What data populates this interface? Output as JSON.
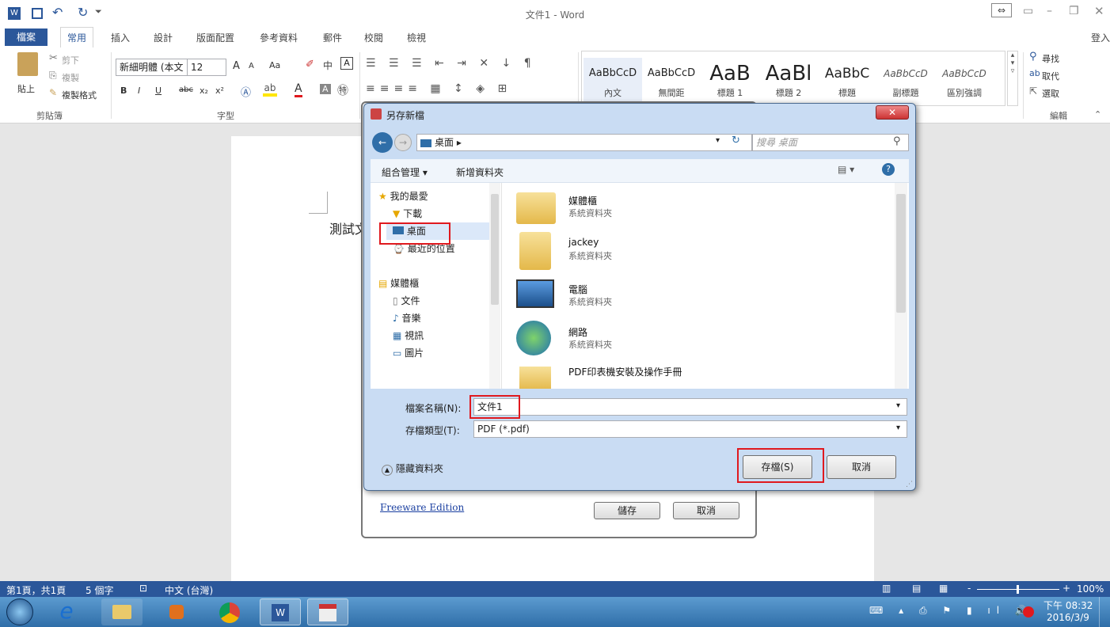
{
  "window": {
    "title": "文件1 - Word",
    "signin": "登入"
  },
  "ribbon_tabs": [
    "檔案",
    "常用",
    "插入",
    "設計",
    "版面配置",
    "參考資料",
    "郵件",
    "校閱",
    "檢視"
  ],
  "clipboard": {
    "paste": "貼上",
    "cut": "剪下",
    "copy": "複製",
    "format_painter": "複製格式",
    "group": "剪貼簿"
  },
  "font": {
    "name": "新細明體 (本文",
    "size": "12",
    "group": "字型",
    "grow": "A",
    "shrink": "A",
    "case": "Aa",
    "bold": "B",
    "italic": "I",
    "underline": "U",
    "strike": "abc",
    "sub": "x₂",
    "sup": "x²",
    "fontcolor": "A",
    "charborder": "A"
  },
  "styles": [
    {
      "preview": "AaBbCcD",
      "name": "內文"
    },
    {
      "preview": "AaBbCcD",
      "name": "無間距"
    },
    {
      "preview": "AaB",
      "name": "標題 1"
    },
    {
      "preview": "AaBl",
      "name": "標題 2"
    },
    {
      "preview": "AaBbC",
      "name": "標題"
    },
    {
      "preview": "AaBbCcD",
      "name": "副標題"
    },
    {
      "preview": "AaBbCcD",
      "name": "區別強調"
    }
  ],
  "editing": {
    "find": "尋找",
    "replace": "取代",
    "select": "選取",
    "group": "編輯"
  },
  "document": {
    "text": "測試文"
  },
  "status": {
    "page": "第1頁，共1頁",
    "words": "5 個字",
    "lang": "中文 (台灣)",
    "zoom": "100%"
  },
  "clock": {
    "time": "下午 08:32",
    "date": "2016/3/9"
  },
  "bg_dialog": {
    "link": "Freeware Edition",
    "save": "儲存",
    "cancel": "取消"
  },
  "dialog": {
    "title": "另存新檔",
    "path": "桌面",
    "search_placeholder": "搜尋 桌面",
    "organize": "組合管理 ▾",
    "new_folder": "新增資料夾",
    "nav": [
      {
        "label": "我的最愛",
        "indent": 0
      },
      {
        "label": "下載",
        "indent": 1
      },
      {
        "label": "桌面",
        "indent": 1
      },
      {
        "label": "最近的位置",
        "indent": 1
      },
      {
        "label": "媒體櫃",
        "indent": 0
      },
      {
        "label": "文件",
        "indent": 1
      },
      {
        "label": "音樂",
        "indent": 1
      },
      {
        "label": "視訊",
        "indent": 1
      },
      {
        "label": "圖片",
        "indent": 1
      }
    ],
    "files": [
      {
        "name": "媒體櫃",
        "type": "系統資料夾"
      },
      {
        "name": "jackey",
        "type": "系統資料夾"
      },
      {
        "name": "電腦",
        "type": "系統資料夾"
      },
      {
        "name": "網路",
        "type": "系統資料夾"
      },
      {
        "name": "PDF印表機安裝及操作手冊",
        "type": ""
      }
    ],
    "filename_label": "檔案名稱(N):",
    "filename": "文件1",
    "filetype_label": "存檔類型(T):",
    "filetype": "PDF (*.pdf)",
    "hide_folders": "隱藏資料夾",
    "save": "存檔(S)",
    "cancel": "取消"
  }
}
